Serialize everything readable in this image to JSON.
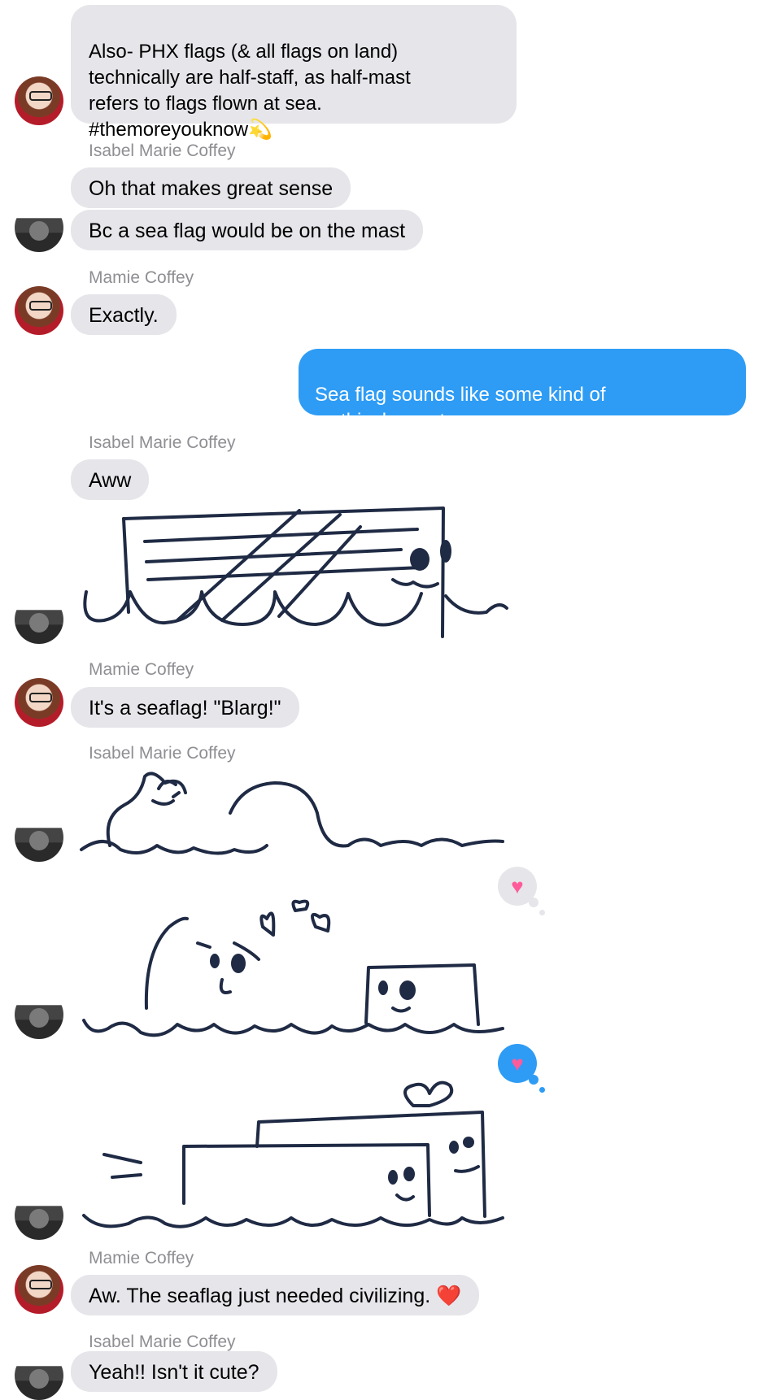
{
  "messages": {
    "m1": "Also- PHX flags (& all flags on land)\n technically are half-staff, as half-mast\nrefers to flags flown at sea.\n#themoreyouknow",
    "m1_emoji": "💫",
    "name1": "Isabel Marie Coffey",
    "m2": "Oh that makes great sense",
    "m3": "Bc a sea flag would be on the mast",
    "name2": "Mamie Coffey",
    "m4": "Exactly.",
    "m5": "Sea flag sounds like some kind of\nmythical monster.",
    "name3": "Isabel Marie Coffey",
    "m6": "Aww",
    "name4": "Mamie Coffey",
    "m7": "It's a seaflag! \"Blarg!\"",
    "name5": "Isabel Marie Coffey",
    "name6": "Mamie Coffey",
    "m8": "Aw. The seaflag just needed civilizing.",
    "m8_emoji": "❤️",
    "name7": "Isabel Marie Coffey",
    "m9": "Yeah!! Isn't it cute?"
  },
  "reactions": {
    "r1": "♥",
    "r2": "♥"
  },
  "colors": {
    "incoming_bubble": "#e5e5ea",
    "outgoing_bubble": "#2e9cf5",
    "drawing_ink": "#1f2a44",
    "sender_name": "#8e8e93"
  }
}
